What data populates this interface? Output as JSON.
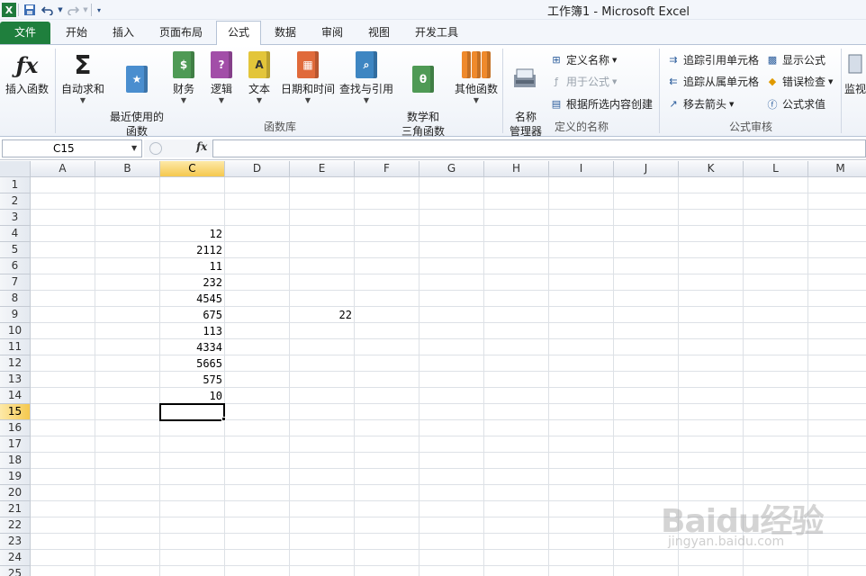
{
  "window": {
    "title": "工作簿1 - Microsoft Excel"
  },
  "qat": {
    "logo": "X",
    "save_icon": "save-icon",
    "undo_icon": "undo-icon",
    "redo_icon": "redo-icon",
    "customize_icon": "customize-icon"
  },
  "tabs": [
    "文件",
    "开始",
    "插入",
    "页面布局",
    "公式",
    "数据",
    "审阅",
    "视图",
    "开发工具"
  ],
  "active_tab": "公式",
  "ribbon": {
    "function_library": {
      "label": "函数库",
      "buttons": [
        {
          "label": "插入函数",
          "icon": "fx-icon"
        },
        {
          "label": "自动求和",
          "icon": "sigma-icon"
        },
        {
          "label": "最近使用的\n函数",
          "icon": "recent-book-icon"
        },
        {
          "label": "财务",
          "icon": "finance-book-icon"
        },
        {
          "label": "逻辑",
          "icon": "logic-book-icon"
        },
        {
          "label": "文本",
          "icon": "text-book-icon"
        },
        {
          "label": "日期和时间",
          "icon": "date-book-icon"
        },
        {
          "label": "查找与引用",
          "icon": "lookup-book-icon"
        },
        {
          "label": "数学和\n三角函数",
          "icon": "math-book-icon"
        },
        {
          "label": "其他函数",
          "icon": "more-books-icon"
        }
      ]
    },
    "defined_names": {
      "label": "定义的名称",
      "name_manager": "名称\n管理器",
      "define_name": "定义名称",
      "use_in_formula": "用于公式",
      "create_from_selection": "根据所选内容创建"
    },
    "formula_auditing": {
      "label": "公式审核",
      "trace_precedents": "追踪引用单元格",
      "trace_dependents": "追踪从属单元格",
      "remove_arrows": "移去箭头",
      "show_formulas": "显示公式",
      "error_checking": "错误检查",
      "evaluate_formula": "公式求值",
      "watch_window": "监视"
    }
  },
  "formula_bar": {
    "name_box": "C15",
    "fx": "fx",
    "formula": ""
  },
  "columns": [
    "A",
    "B",
    "C",
    "D",
    "E",
    "F",
    "G",
    "H",
    "I",
    "J",
    "K",
    "L",
    "M"
  ],
  "selected_column": "C",
  "rows": [
    "1",
    "2",
    "3",
    "4",
    "5",
    "6",
    "7",
    "8",
    "9",
    "10",
    "11",
    "12",
    "13",
    "14",
    "15",
    "16",
    "17",
    "18",
    "19",
    "20",
    "21",
    "22",
    "23",
    "24",
    "25"
  ],
  "selected_row": "15",
  "cells": {
    "C4": "12",
    "C5": "2112",
    "C6": "11",
    "C7": "232",
    "C8": "4545",
    "C9": "675",
    "C10": "113",
    "C11": "4334",
    "C12": "5665",
    "C13": "575",
    "C14": "10",
    "E9": "22"
  },
  "watermark": {
    "logo": "Baidu经验",
    "sub": "jingyan.baidu.com"
  }
}
